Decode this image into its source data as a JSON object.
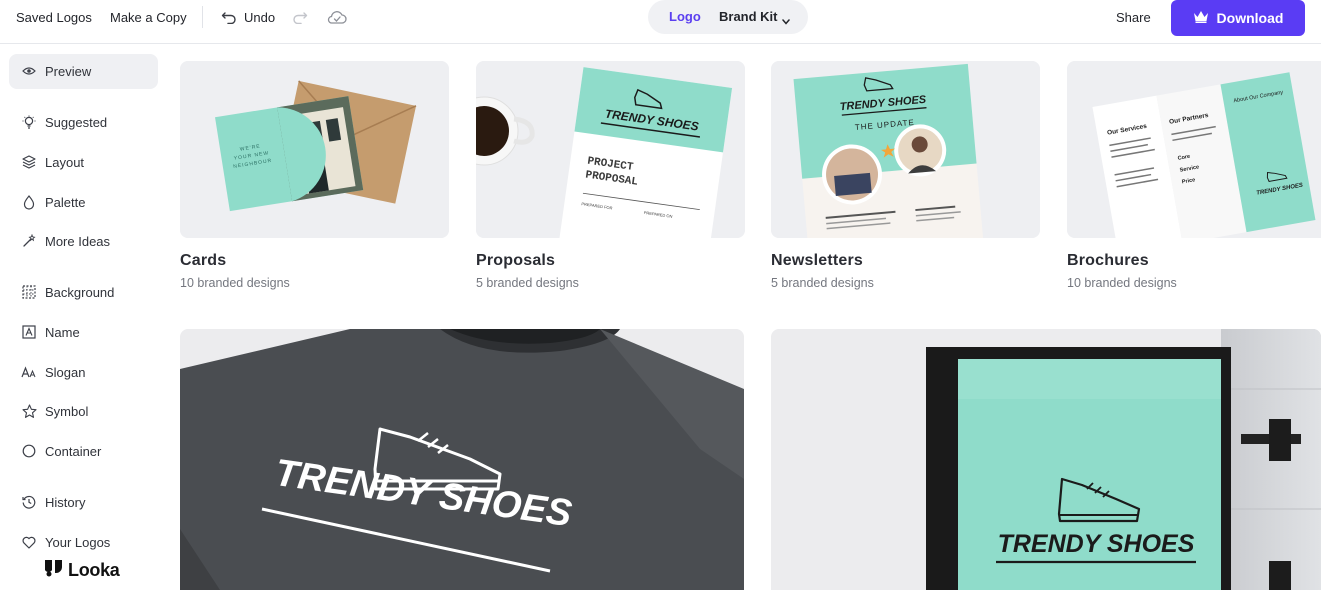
{
  "toolbar": {
    "saved_logos": "Saved Logos",
    "make_copy": "Make a Copy",
    "undo": "Undo",
    "mode_logo": "Logo",
    "mode_brand_kit": "Brand Kit",
    "share": "Share",
    "download": "Download"
  },
  "sidebar": {
    "items": [
      {
        "label": "Preview",
        "icon": "eye-icon"
      },
      {
        "label": "Suggested",
        "icon": "lightbulb-icon"
      },
      {
        "label": "Layout",
        "icon": "layers-icon"
      },
      {
        "label": "Palette",
        "icon": "droplet-icon"
      },
      {
        "label": "More Ideas",
        "icon": "magic-wand-icon"
      },
      {
        "label": "Background",
        "icon": "grid-icon"
      },
      {
        "label": "Name",
        "icon": "text-box-icon"
      },
      {
        "label": "Slogan",
        "icon": "font-size-icon"
      },
      {
        "label": "Symbol",
        "icon": "star-icon"
      },
      {
        "label": "Container",
        "icon": "circle-icon"
      },
      {
        "label": "History",
        "icon": "history-icon"
      },
      {
        "label": "Your Logos",
        "icon": "heart-icon"
      }
    ],
    "brand": "Looka"
  },
  "cards": [
    {
      "title": "Cards",
      "subtitle": "10 branded designs"
    },
    {
      "title": "Proposals",
      "subtitle": "5 branded designs"
    },
    {
      "title": "Newsletters",
      "subtitle": "5 branded designs"
    },
    {
      "title": "Brochures",
      "subtitle": "10 branded designs"
    }
  ],
  "mockups": {
    "brand_name": "TRENDY SHOES",
    "card_text_1": "WE'RE",
    "card_text_2": "YOUR NEW",
    "card_text_3": "NEIGHBOUR",
    "proposal_title_1": "PROJECT",
    "proposal_title_2": "PROPOSAL",
    "proposal_small_1": "PREPARED FOR",
    "proposal_small_2": "PREPARED ON",
    "newsletter_heading": "THE UPDATE",
    "brochure_services": "Our Services",
    "brochure_partners": "Our Partners",
    "brochure_about": "About Our Company",
    "brochure_bullets": [
      "Core",
      "Service",
      "Price"
    ]
  },
  "colors": {
    "accent": "#5a3cf4",
    "mint": "#8fdcca",
    "active_bg": "#eff0f3"
  }
}
